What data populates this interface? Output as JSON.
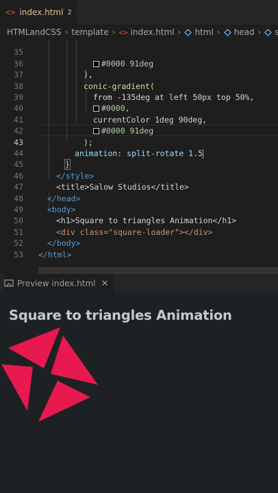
{
  "tab": {
    "icon": "<>",
    "label": "index.html",
    "count": "2"
  },
  "breadcrumb": [
    {
      "text": "HTMLandCSS",
      "icon": ""
    },
    {
      "text": "template",
      "icon": ""
    },
    {
      "text": "index.html",
      "icon": "html-icon"
    },
    {
      "text": "html",
      "icon": "tag-icon"
    },
    {
      "text": "head",
      "icon": "tag-icon"
    },
    {
      "text": "style",
      "icon": "tag-icon"
    }
  ],
  "editor": {
    "active_line": 43,
    "lines": [
      {
        "n": "35",
        "code": "#0000 91deg"
      },
      {
        "n": "36",
        "code": "),"
      },
      {
        "n": "37",
        "code": "conic-gradient("
      },
      {
        "n": "38",
        "code": "from -135deg at left 50px top 50%,"
      },
      {
        "n": "39",
        "code": "#0000,"
      },
      {
        "n": "40",
        "code": "currentColor 1deg 90deg,"
      },
      {
        "n": "41",
        "code": "#0000 91deg"
      },
      {
        "n": "42",
        "code": ");"
      },
      {
        "n": "43",
        "code": "animation: split-rotate 1.5"
      },
      {
        "n": "44",
        "code": "}"
      },
      {
        "n": "45",
        "code": "</style>"
      },
      {
        "n": "46",
        "code": "<title>Salow Studios</title>"
      },
      {
        "n": "47",
        "code": "</head>"
      },
      {
        "n": "48",
        "code": "<body>"
      },
      {
        "n": "49",
        "code": "<h1>Square to triangles Animation</h1>"
      },
      {
        "n": "50",
        "code": "<div class=\"square-loader\"></div>"
      },
      {
        "n": "51",
        "code": "</body>"
      },
      {
        "n": "52",
        "code": "</html>"
      },
      {
        "n": "53",
        "code": ""
      }
    ]
  },
  "preview_panel": {
    "tab_label": "Preview index.html",
    "close_glyph": "✕"
  },
  "preview": {
    "heading": "Square to triangles Animation",
    "loader_color": "#e8194f"
  },
  "colors": {
    "editor_bg": "#1e1e1e",
    "accent_red": "#e8194f",
    "html_icon": "#e44d26"
  }
}
